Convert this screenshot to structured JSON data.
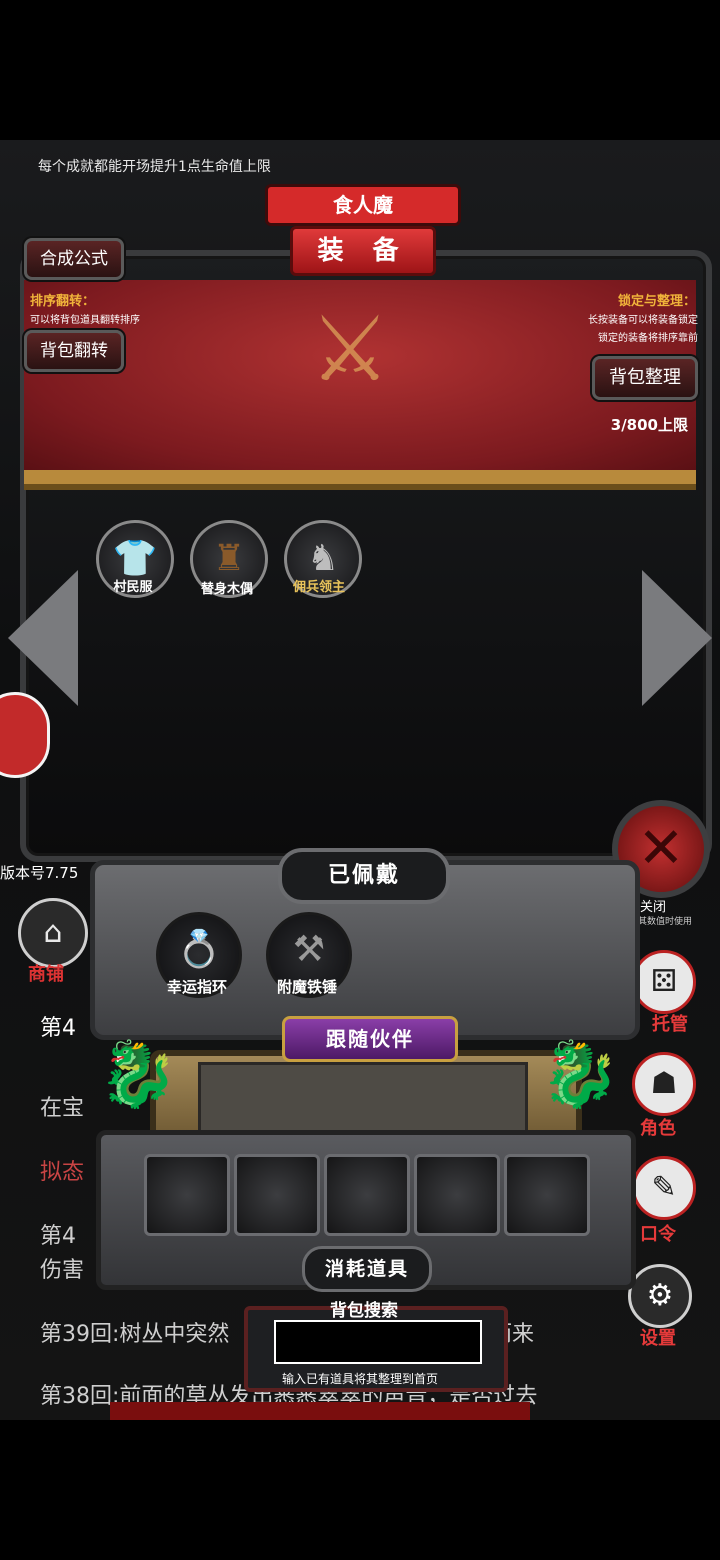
{
  "hint": "每个成就都能开场提升1点生命值上限",
  "title": {
    "top": "食人魔",
    "main": "装 备"
  },
  "buttons": {
    "craft": "合成公式",
    "flip": "背包翻转",
    "sort": "背包整理",
    "close": "关闭"
  },
  "sort_info": {
    "title": "排序翻转：",
    "desc": "可以将背包道具翻转排序"
  },
  "lock_info": {
    "title": "锁定与整理：",
    "desc1": "长按装备可以将装备锁定",
    "desc2": "锁定的装备将排序靠前"
  },
  "capacity": "3/800上限",
  "items": [
    {
      "label": "村民服",
      "icon": "shirt-icon"
    },
    {
      "label": "替身木偶",
      "icon": "wooden-puppet-icon"
    },
    {
      "label": "佣兵领主",
      "icon": "armored-knight-icon"
    }
  ],
  "close_sub": "其数值时使用",
  "version": "版本号7.75",
  "shop": "商铺",
  "equipped": {
    "title": "已佩戴",
    "items": [
      {
        "label": "幸运指环",
        "icon": "ring-icon"
      },
      {
        "label": "附魔铁锤",
        "icon": "hammer-icon"
      }
    ]
  },
  "companion": {
    "title": "跟随伙伴"
  },
  "consumables": {
    "title": "消耗道具"
  },
  "search": {
    "title": "背包搜索",
    "hint": "输入已有道具将其整理到首页",
    "value": ""
  },
  "side_menu": [
    {
      "label": "托管",
      "icon": "dice-icon"
    },
    {
      "label": "角色",
      "icon": "hooded-figure-icon"
    },
    {
      "label": "口令",
      "icon": "scroll-icon"
    },
    {
      "label": "设置",
      "icon": "gear-icon"
    }
  ],
  "log": [
    "第4",
    "在宝",
    "拟态",
    "第4",
    "伤害",
    "第39回:树丛中突然",
    "第38回:前面的草丛发出窸窸窣窣的声音，是否过去"
  ],
  "log_right": "而来",
  "colors": {
    "accent_red": "#b03232",
    "gold": "#f0b33a"
  }
}
